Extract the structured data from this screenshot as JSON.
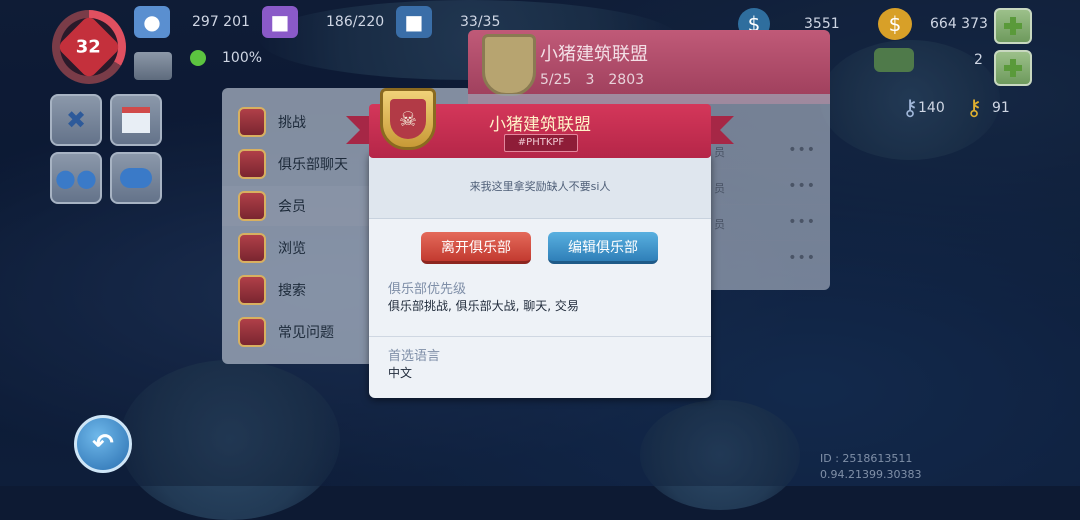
{
  "hud": {
    "level": "32",
    "population": "297 201",
    "storage": "186/220",
    "items": "33/35",
    "simcash": "3551",
    "coins": "664 373",
    "happiness": "100%",
    "keys_a": "2",
    "keys_b": "140",
    "keys_c": "91"
  },
  "club_menu": {
    "items": [
      {
        "label": "挑战",
        "icon": "chest-icon"
      },
      {
        "label": "俱乐部聊天",
        "icon": "chat-icon"
      },
      {
        "label": "会员",
        "icon": "bank-icon"
      },
      {
        "label": "浏览",
        "icon": "list-icon"
      },
      {
        "label": "搜索",
        "icon": "search-icon"
      },
      {
        "label": "常见问题",
        "icon": "book-icon"
      }
    ]
  },
  "club_header": {
    "name": "小猪建筑联盟",
    "members": "5/25",
    "towers": "3",
    "points": "2803"
  },
  "members_rows": [
    {
      "role": "员"
    },
    {
      "role": "员"
    },
    {
      "role": "员"
    }
  ],
  "dialog": {
    "title": "小猪建筑联盟",
    "tag": "#PHTKPF",
    "description": "来我这里拿奖励缺人不要si人",
    "leave_label": "离开俱乐部",
    "edit_label": "编辑俱乐部",
    "priority_label": "俱乐部优先级",
    "priority_value": "俱乐部挑战, 俱乐部大战, 聊天, 交易",
    "language_label": "首选语言",
    "language_value": "中文"
  },
  "footer": {
    "id": "ID : 2518613511",
    "version": "0.94.21399.30383"
  },
  "colors": {
    "ribbon": "#c12e50",
    "leave_button": "#d24a3e",
    "edit_button": "#3f92c8",
    "plus_button": "#7ca86a"
  }
}
